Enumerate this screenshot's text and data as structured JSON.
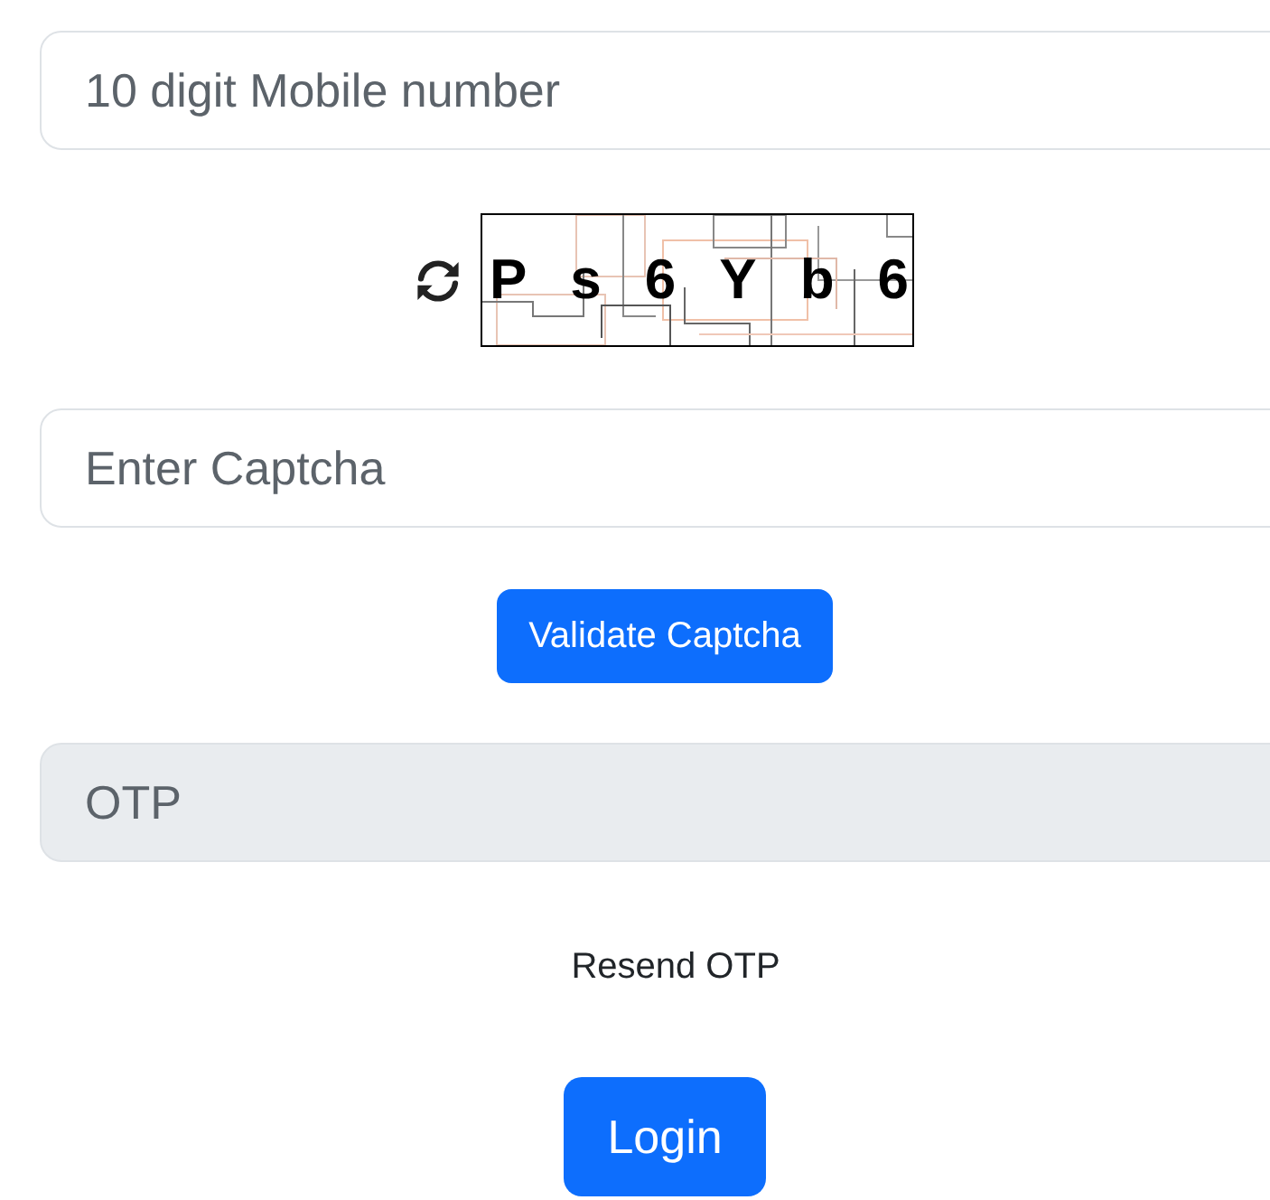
{
  "mobile_field": {
    "placeholder": "10 digit Mobile number",
    "disabled": false
  },
  "captcha": {
    "characters": [
      "P",
      "s",
      "6",
      "Y",
      "b",
      "6"
    ]
  },
  "captcha_field": {
    "placeholder": "Enter Captcha",
    "disabled": false
  },
  "validate_button": {
    "label": "Validate Captcha"
  },
  "otp_field": {
    "placeholder": "OTP",
    "disabled": true
  },
  "resend_link": {
    "label": "Resend OTP"
  },
  "login_button": {
    "label": "Login"
  }
}
